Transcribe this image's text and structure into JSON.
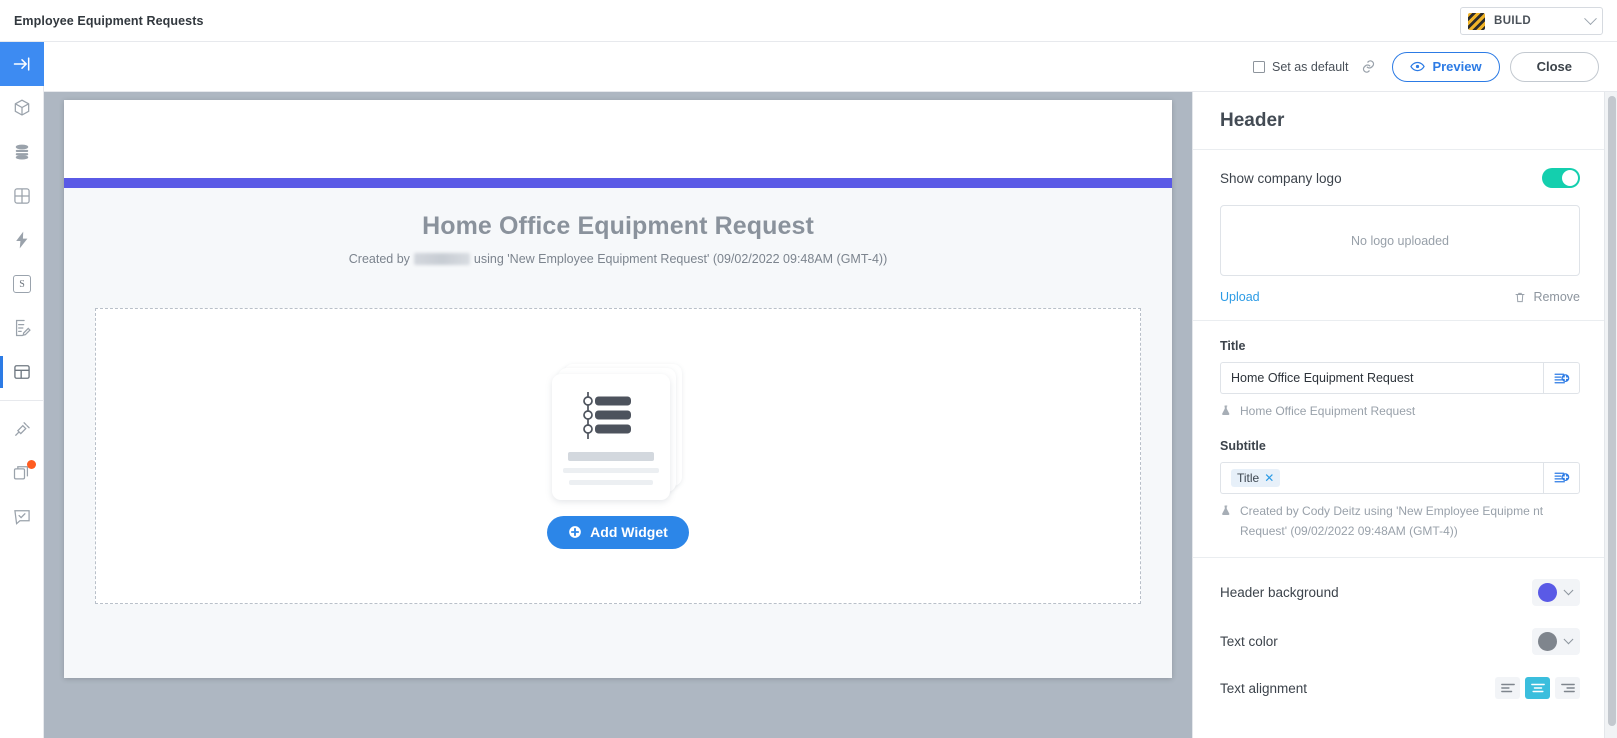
{
  "topbar": {
    "app_title": "Employee Equipment Requests",
    "mode_select": {
      "label": "BUILD",
      "swatch_name": "hazard-stripes-icon",
      "chevron": "chevron-down-icon"
    }
  },
  "toolbar": {
    "set_as_default_label": "Set as default",
    "set_as_default_checked": false,
    "link_icon": "link-icon",
    "preview_label": "Preview",
    "preview_icon": "eye-icon",
    "close_label": "Close"
  },
  "rail": {
    "items": [
      {
        "name": "collapse-panel-icon",
        "state": "active-blue"
      },
      {
        "name": "cube-icon",
        "state": "default"
      },
      {
        "name": "database-icon",
        "state": "default"
      },
      {
        "name": "grid-icon",
        "state": "default"
      },
      {
        "name": "lightning-icon",
        "state": "default"
      },
      {
        "name": "script-s-icon",
        "label": "S",
        "state": "default"
      },
      {
        "name": "document-edit-icon",
        "state": "default"
      },
      {
        "name": "layout-icon",
        "state": "active-mark"
      },
      {
        "name": "plug-icon",
        "state": "default"
      },
      {
        "name": "stacked-cards-icon",
        "state": "badged",
        "badge": true
      },
      {
        "name": "task-check-icon",
        "state": "default"
      }
    ]
  },
  "canvas": {
    "accent_color": "#5a5ae6",
    "doc_title": "Home Office Equipment Request",
    "subtitle_prefix": "Created by",
    "subtitle_redacted": true,
    "subtitle_suffix": "using 'New Employee Equipment Request' (09/02/2022 09:48AM (GMT-4))",
    "add_widget_label": "Add Widget",
    "add_widget_icon": "plus-circle-icon",
    "empty_illustration": "stacked-cards-list-illustration"
  },
  "panel": {
    "title": "Header",
    "show_company_logo": {
      "label": "Show company logo",
      "enabled": true
    },
    "logo_placeholder": "No logo uploaded",
    "upload_label": "Upload",
    "remove_label": "Remove",
    "remove_icon": "trash-icon",
    "title_field": {
      "label": "Title",
      "value": "Home Office Equipment Request",
      "insert_variable_icon": "insert-variable-icon",
      "preview_icon": "flask-icon",
      "preview_text": "Home Office Equipment Request"
    },
    "subtitle_field": {
      "label": "Subtitle",
      "chip_label": "Title",
      "chip_remove_icon": "close-icon",
      "insert_variable_icon": "insert-variable-icon",
      "preview_icon": "flask-icon",
      "preview_text": "Created by Cody Deitz using 'New Employee Equipme nt Request' (09/02/2022 09:48AM (GMT-4))"
    },
    "header_background": {
      "label": "Header background",
      "color": "#5a5ae6"
    },
    "text_color": {
      "label": "Text color",
      "color": "#7f858d"
    },
    "text_alignment": {
      "label": "Text alignment",
      "selected": "center",
      "options": [
        "left",
        "center",
        "right"
      ]
    }
  }
}
